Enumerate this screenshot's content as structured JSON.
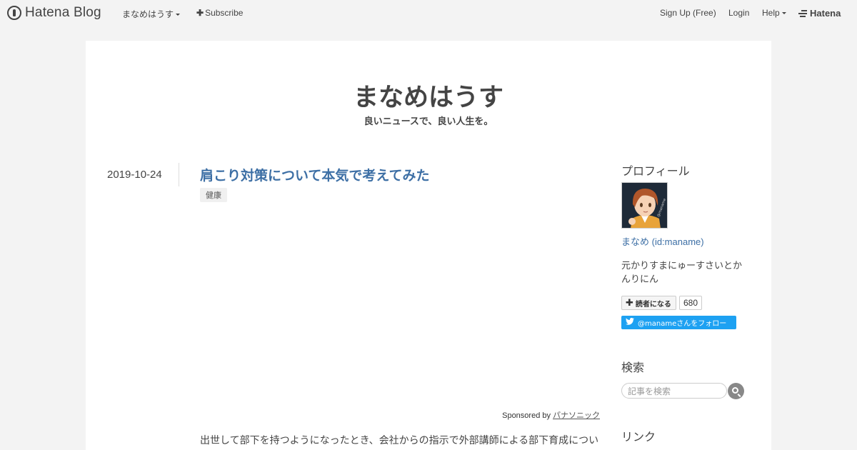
{
  "global_header": {
    "logo_text": "Hatena Blog",
    "blog_menu_label": "まなめはうす",
    "subscribe_label": "Subscribe",
    "signup_label": "Sign Up (Free)",
    "login_label": "Login",
    "help_label": "Help",
    "brand_label": "Hatena"
  },
  "blog": {
    "title": "まなめはうす",
    "description": "良いニュースで、良い人生を。"
  },
  "entry": {
    "date": "2019-10-24",
    "title": "肩こり対策について本気で考えてみた",
    "category": "健康",
    "sponsored_prefix": "Sponsored by",
    "sponsored_advertiser": "パナソニック",
    "body_first_line": "出世して部下を持つようになったとき、会社からの指示で外部講師による部下育成につい"
  },
  "sidebar": {
    "profile_heading": "プロフィール",
    "profile_name": "まなめ (id:maname)",
    "profile_bio": "元かりすまにゅーすさいとかんりにん",
    "reader_button_label": "読者になる",
    "reader_count": "680",
    "twitter_follow_label": "@manameさんをフォロー",
    "search_heading": "検索",
    "search_placeholder": "記事を検索",
    "link_heading": "リンク"
  },
  "colors": {
    "page_bg": "#f3f3f3",
    "link_blue": "#3d6fa5",
    "twitter_blue": "#1da1f2"
  },
  "icons": [
    "hatena-blog-logo-icon",
    "caret-down-icon",
    "plus-icon",
    "hatena-logo-icon",
    "twitter-bird-icon",
    "search-icon"
  ]
}
